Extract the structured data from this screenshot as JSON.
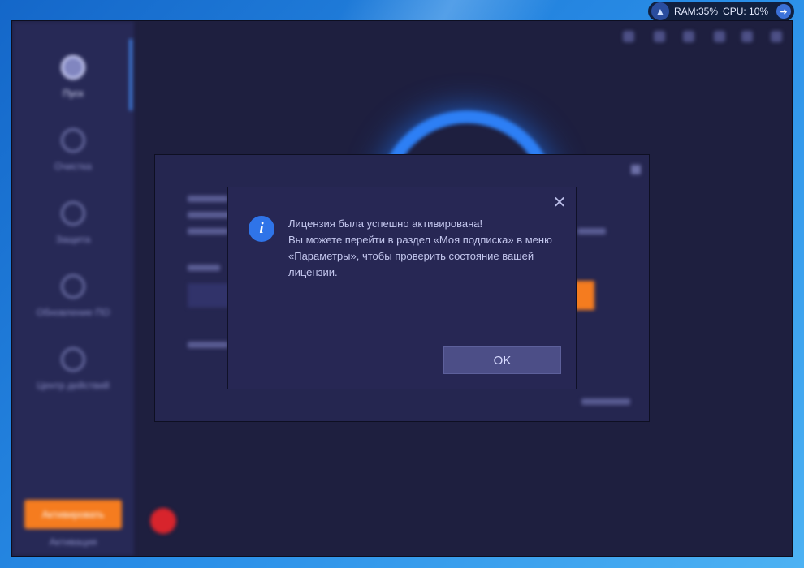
{
  "tray": {
    "ram_label": "RAM:35%",
    "cpu_label": "CPU: 10%"
  },
  "app": {
    "sidebar_items": [
      {
        "label": "Пуск"
      },
      {
        "label": "Очистка"
      },
      {
        "label": "Защита"
      },
      {
        "label": "Обновление ПО"
      },
      {
        "label": "Центр действий"
      }
    ],
    "upgrade_button": "Активировать",
    "activate_link": "Активация"
  },
  "dialog": {
    "message_lines": [
      "Лицензия была успешно активирована!",
      "Вы можете перейти в раздел «Моя подписка» в меню «Параметры», чтобы проверить состояние вашей лицензии."
    ],
    "ok_label": "OK",
    "close_label": "✕"
  },
  "colors": {
    "accent": "#2f74e8",
    "dialog_bg": "#272754",
    "upgrade_orange": "#f57c1f"
  }
}
